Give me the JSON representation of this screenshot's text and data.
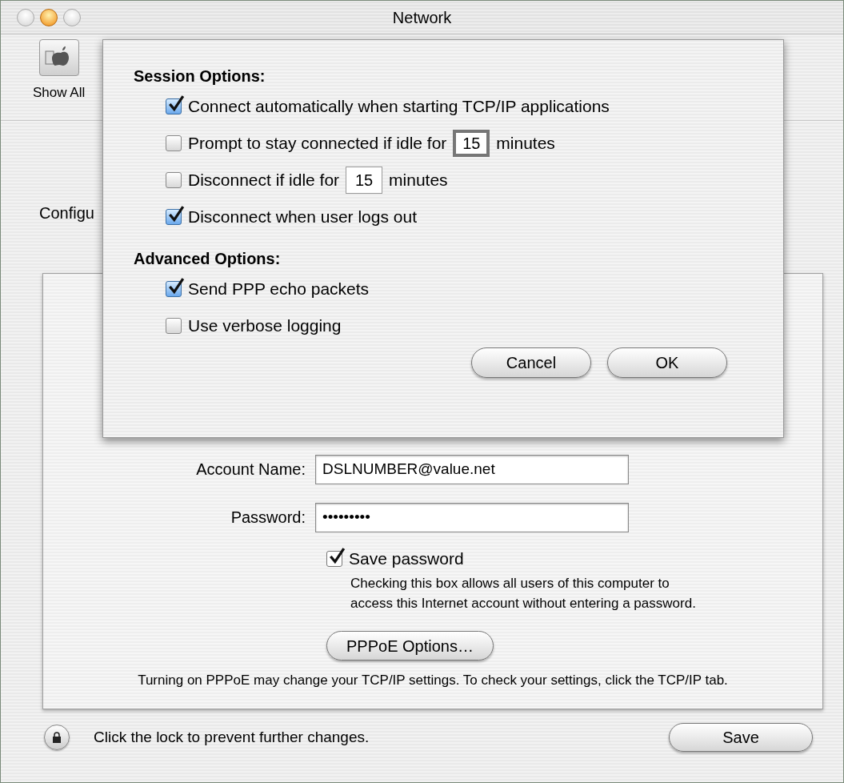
{
  "window": {
    "title": "Network"
  },
  "toolbar": {
    "items": [
      {
        "label": "Show All"
      }
    ]
  },
  "configure": {
    "label": "Configu"
  },
  "pppoe": {
    "account_name": {
      "label": "Account Name:",
      "value": "DSLNUMBER@value.net"
    },
    "password": {
      "label": "Password:",
      "value": "•••••••••"
    },
    "save_password": {
      "label": "Save password",
      "checked": true,
      "description_lines": [
        "Checking this box allows all users of this computer to",
        "access this Internet account without entering a password."
      ]
    },
    "options_button": "PPPoE Options…",
    "note": "Turning on PPPoE may change your TCP/IP settings. To check your settings, click the TCP/IP tab."
  },
  "lock": {
    "text": "Click the lock to prevent further changes."
  },
  "save_button": "Save",
  "sheet": {
    "sections": [
      {
        "title": "Session Options:",
        "options": [
          {
            "kind": "checkbox",
            "label": "Connect automatically when starting TCP/IP applications",
            "checked": true
          },
          {
            "kind": "idle",
            "label": "Prompt to stay connected if idle for",
            "value": "15",
            "suffix": "minutes",
            "checked": false,
            "focused": true
          },
          {
            "kind": "idle",
            "label": "Disconnect if idle for",
            "value": "15",
            "suffix": "minutes",
            "checked": false,
            "focused": false
          },
          {
            "kind": "checkbox",
            "label": "Disconnect when user logs out",
            "checked": true
          }
        ]
      },
      {
        "title": "Advanced Options:",
        "options": [
          {
            "kind": "checkbox",
            "label": "Send PPP echo packets",
            "checked": true
          },
          {
            "kind": "checkbox",
            "label": "Use verbose logging",
            "checked": false
          }
        ]
      }
    ],
    "buttons": [
      {
        "label": "Cancel"
      },
      {
        "label": "OK"
      }
    ]
  }
}
